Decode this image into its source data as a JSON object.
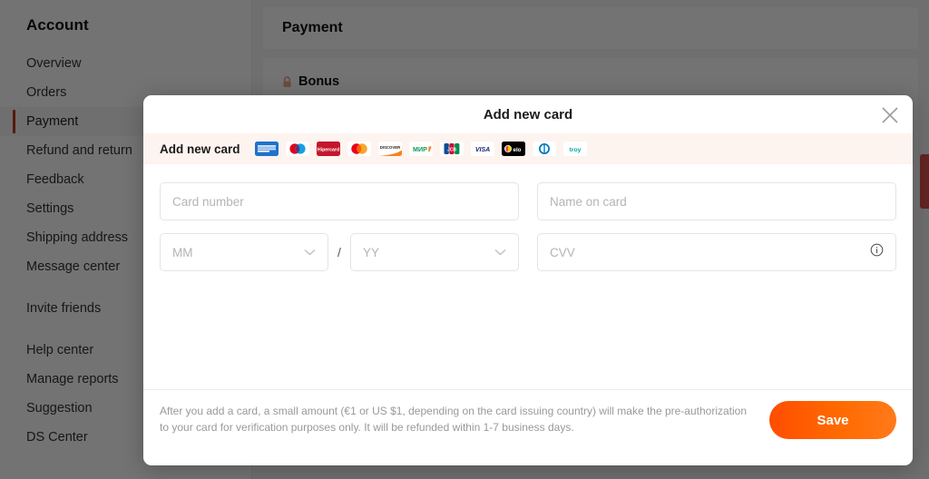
{
  "sidebar": {
    "title": "Account",
    "items": [
      {
        "label": "Overview",
        "active": false
      },
      {
        "label": "Orders",
        "active": false
      },
      {
        "label": "Payment",
        "active": true
      },
      {
        "label": "Refund and return",
        "active": false
      },
      {
        "label": "Feedback",
        "active": false
      },
      {
        "label": "Settings",
        "active": false
      },
      {
        "label": "Shipping address",
        "active": false
      },
      {
        "label": "Message center",
        "active": false
      },
      {
        "label": "Invite friends",
        "active": false
      },
      {
        "label": "Help center",
        "active": false
      },
      {
        "label": "Manage reports",
        "active": false
      },
      {
        "label": "Suggestion",
        "active": false
      },
      {
        "label": "DS Center",
        "active": false
      }
    ]
  },
  "background": {
    "page_title": "Payment",
    "bonus_label": "Bonus"
  },
  "modal": {
    "title": "Add new card",
    "close_icon": "close-icon",
    "band_label": "Add new card",
    "brands": [
      {
        "name": "american-express",
        "short": "AMEX"
      },
      {
        "name": "maestro",
        "short": "Maestro"
      },
      {
        "name": "hipercard",
        "short": "Hipercard"
      },
      {
        "name": "mastercard",
        "short": "Mastercard"
      },
      {
        "name": "discover",
        "short": "DISCOVER"
      },
      {
        "name": "mir",
        "short": "МИР"
      },
      {
        "name": "jcb",
        "short": "JCB"
      },
      {
        "name": "visa",
        "short": "VISA"
      },
      {
        "name": "elo",
        "short": "elo"
      },
      {
        "name": "diners-club",
        "short": "Diners Club"
      },
      {
        "name": "troy",
        "short": "troy"
      }
    ],
    "fields": {
      "card_number_placeholder": "Card number",
      "name_on_card_placeholder": "Name on card",
      "month_placeholder": "MM",
      "year_placeholder": "YY",
      "date_separator": "/",
      "cvv_placeholder": "CVV"
    },
    "footer_note": "After you add a card, a small amount (€1 or US $1, depending on the card issuing country) will make the pre-authorization to your card for verification purposes only. It will be refunded within 1-7 business days.",
    "save_label": "Save"
  },
  "colors": {
    "accent_orange": "#ff5000",
    "active_red": "#c03a21",
    "band_bg": "#fdf3ef",
    "placeholder": "#b4b4b4",
    "note_gray": "#999999"
  }
}
